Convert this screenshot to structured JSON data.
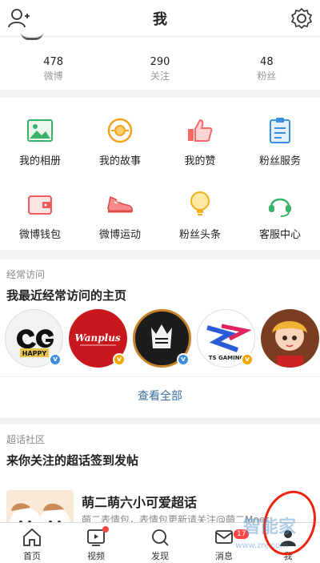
{
  "header": {
    "title": "我"
  },
  "stats": [
    {
      "value": "478",
      "label": "微博"
    },
    {
      "value": "290",
      "label": "关注"
    },
    {
      "value": "48",
      "label": "粉丝"
    }
  ],
  "grid": [
    {
      "label": "我的相册",
      "icon": "photo-album-icon"
    },
    {
      "label": "我的故事",
      "icon": "story-icon"
    },
    {
      "label": "我的赞",
      "icon": "thumbs-up-icon"
    },
    {
      "label": "粉丝服务",
      "icon": "clipboard-icon"
    },
    {
      "label": "微博钱包",
      "icon": "wallet-icon"
    },
    {
      "label": "微博运动",
      "icon": "sneaker-icon"
    },
    {
      "label": "粉丝头条",
      "icon": "lightbulb-icon"
    },
    {
      "label": "客服中心",
      "icon": "headset-icon"
    }
  ],
  "frequent": {
    "section_title": "经常访问",
    "subtitle": "我最近经常访问的主页",
    "see_all": "查看全部",
    "avatars": [
      {
        "name": "QG Happy",
        "logo_text": "HAPPY",
        "badge": "v",
        "badge_color": "#3d8bd9"
      },
      {
        "name": "Wanplus",
        "logo_text": "Wanplus",
        "badge": "v",
        "badge_color": "#f0a500"
      },
      {
        "name": "Crown team",
        "badge": "v",
        "badge_color": "#3d8bd9"
      },
      {
        "name": "TS Gaming",
        "logo_text": "TS GAMING",
        "badge": "v",
        "badge_color": "#f0a500"
      },
      {
        "name": "Anime avatar",
        "badge": ""
      }
    ]
  },
  "topic": {
    "section_title": "超话社区",
    "subtitle": "来你关注的超话签到发帖",
    "name": "萌二萌六小可爱超话",
    "desc": "萌二表情包，表情包更新请关注@萌二Moer"
  },
  "tabs": [
    {
      "label": "首页",
      "icon": "home-icon"
    },
    {
      "label": "视频",
      "icon": "video-icon"
    },
    {
      "label": "发现",
      "icon": "search-icon"
    },
    {
      "label": "消息",
      "icon": "message-icon",
      "bubble": "17"
    },
    {
      "label": "我",
      "icon": "profile-icon"
    }
  ],
  "watermark": {
    "text": "智能家",
    "sub": "www.znj.com"
  }
}
